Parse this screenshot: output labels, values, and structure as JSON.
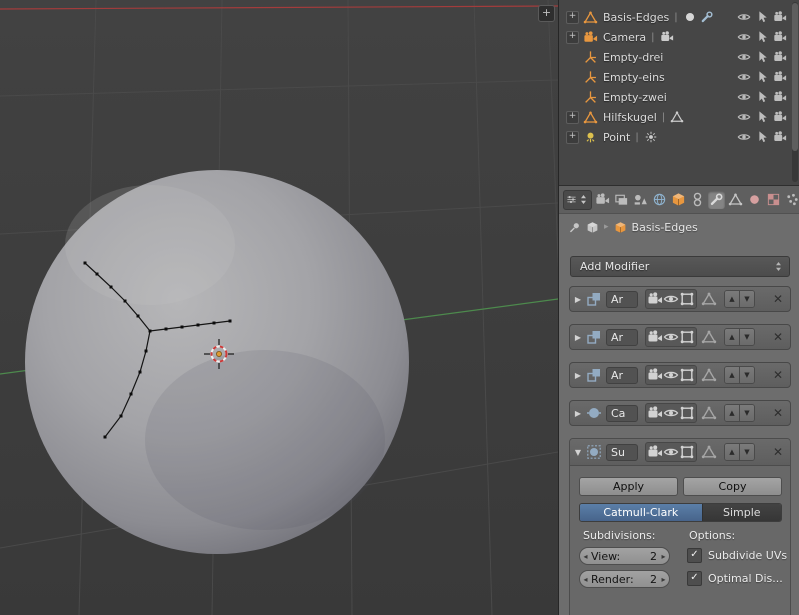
{
  "glyphs": {
    "plus": "+",
    "pipe": "|",
    "close": "✕",
    "collapsed": "▶",
    "expanded": "▼",
    "up": "▲",
    "down": "▼",
    "left_arrow": "◂",
    "right_arrow": "▸",
    "crumb_sep": "▸",
    "check": "✓"
  },
  "outliner": {
    "items": [
      {
        "label": "Basis-Edges"
      },
      {
        "label": "Camera"
      },
      {
        "label": "Empty-drei"
      },
      {
        "label": "Empty-eins"
      },
      {
        "label": "Empty-zwei"
      },
      {
        "label": "Hilfskugel"
      },
      {
        "label": "Point"
      }
    ]
  },
  "properties": {
    "breadcrumb": {
      "object_name": "Basis-Edges"
    },
    "add_modifier": {
      "label": "Add Modifier"
    },
    "modifiers": [
      {
        "name": "Ar"
      },
      {
        "name": "Ar"
      },
      {
        "name": "Ar"
      },
      {
        "name": "Ca"
      },
      {
        "name": "Su"
      }
    ],
    "subsurf": {
      "apply": "Apply",
      "copy": "Copy",
      "catmull_clark": "Catmull-Clark",
      "simple": "Simple",
      "subdivisions": "Subdivisions:",
      "options": "Options:",
      "view_label": "View:",
      "view_value": "2",
      "render_label": "Render:",
      "render_value": "2",
      "subdivide_uvs": "Subdivide UVs",
      "optimal_display": "Optimal Dis..."
    }
  }
}
